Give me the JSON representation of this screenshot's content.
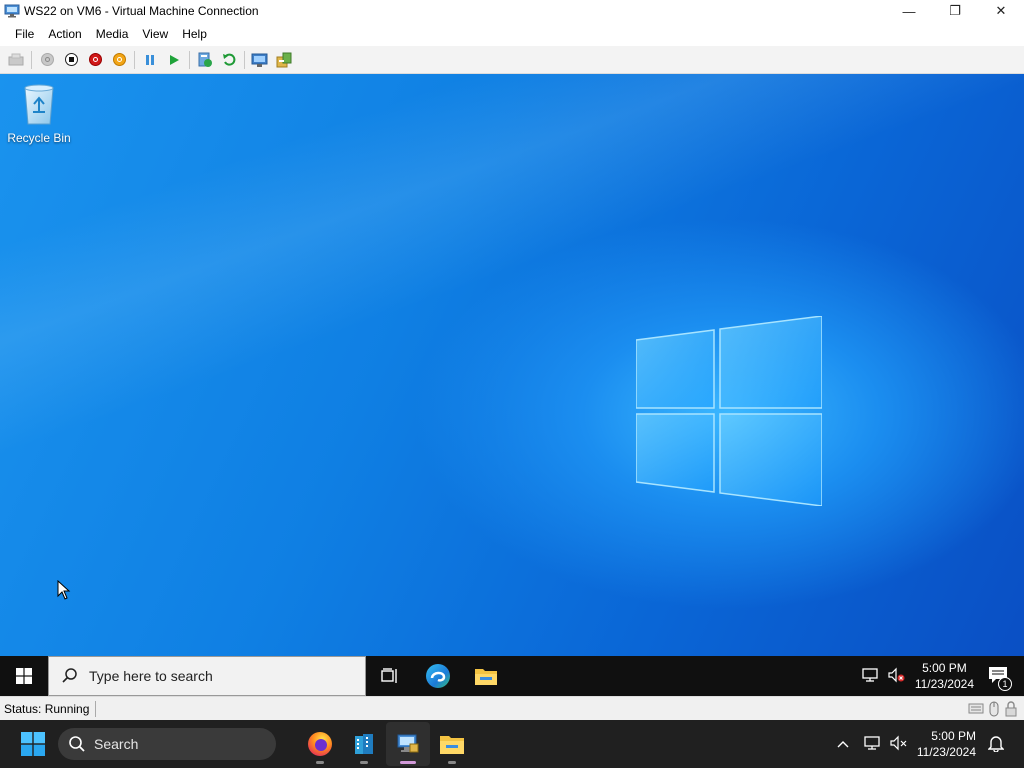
{
  "window": {
    "title": "WS22 on VM6 - Virtual Machine Connection",
    "controls": {
      "minimize": "—",
      "restore": "❐",
      "close": "✕"
    }
  },
  "menu": {
    "items": [
      "File",
      "Action",
      "Media",
      "View",
      "Help"
    ]
  },
  "toolbar": {
    "buttons": [
      "ctrl-alt-del-icon",
      "start-icon",
      "turn-off-icon",
      "shut-down-icon",
      "save-state-icon",
      "pause-icon",
      "resume-icon",
      "checkpoint-icon",
      "revert-icon",
      "enhanced-session-icon",
      "share-icon"
    ]
  },
  "desktop": {
    "recycle_bin_label": "Recycle Bin"
  },
  "guest_taskbar": {
    "search_placeholder": "Type here to search",
    "time": "5:00 PM",
    "date": "11/23/2024",
    "notification_count": "1"
  },
  "status_bar": {
    "status": "Status: Running"
  },
  "host_taskbar": {
    "search_label": "Search",
    "time": "5:00 PM",
    "date": "11/23/2024"
  },
  "colors": {
    "desktop_blue": "#0f7fe3",
    "guest_taskbar": "#101010",
    "host_taskbar": "#202020",
    "active_indicator": "#d29ad9"
  }
}
